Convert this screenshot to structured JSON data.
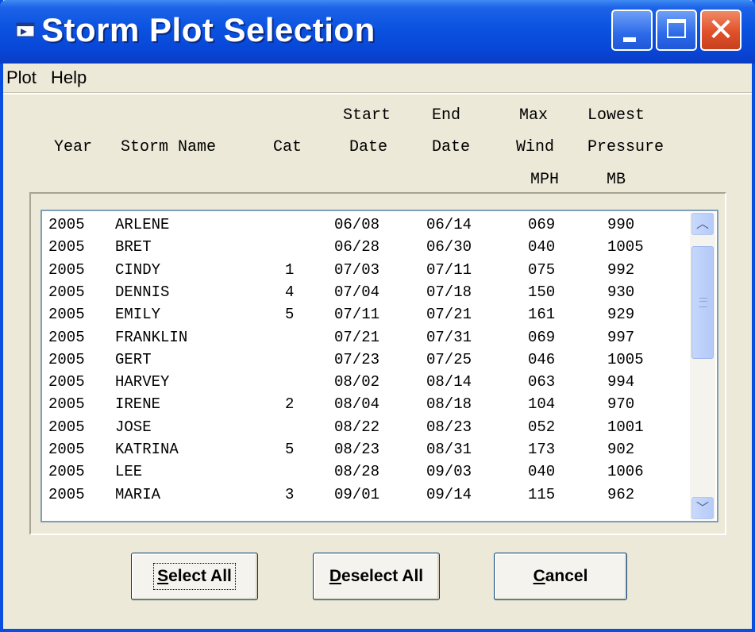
{
  "window": {
    "title": "Storm Plot Selection"
  },
  "menu": [
    {
      "label": "Plot"
    },
    {
      "label": "Help"
    }
  ],
  "headers": {
    "year": "Year",
    "storm_name": "Storm Name",
    "cat": "Cat",
    "start_top": "Start",
    "start_bottom": "Date",
    "end_top": "End",
    "end_bottom": "Date",
    "wind_top": "Max",
    "wind_mid": "Wind",
    "wind_unit": "MPH",
    "pressure_top": "Lowest",
    "pressure_mid": "Pressure",
    "pressure_unit": "MB"
  },
  "storms": [
    {
      "year": "2005",
      "name": "ARLENE",
      "cat": "",
      "start": "06/08",
      "end": "06/14",
      "wind": "069",
      "pressure": "990"
    },
    {
      "year": "2005",
      "name": "BRET",
      "cat": "",
      "start": "06/28",
      "end": "06/30",
      "wind": "040",
      "pressure": "1005"
    },
    {
      "year": "2005",
      "name": "CINDY",
      "cat": "1",
      "start": "07/03",
      "end": "07/11",
      "wind": "075",
      "pressure": "992"
    },
    {
      "year": "2005",
      "name": "DENNIS",
      "cat": "4",
      "start": "07/04",
      "end": "07/18",
      "wind": "150",
      "pressure": "930"
    },
    {
      "year": "2005",
      "name": "EMILY",
      "cat": "5",
      "start": "07/11",
      "end": "07/21",
      "wind": "161",
      "pressure": "929"
    },
    {
      "year": "2005",
      "name": "FRANKLIN",
      "cat": "",
      "start": "07/21",
      "end": "07/31",
      "wind": "069",
      "pressure": "997"
    },
    {
      "year": "2005",
      "name": "GERT",
      "cat": "",
      "start": "07/23",
      "end": "07/25",
      "wind": "046",
      "pressure": "1005"
    },
    {
      "year": "2005",
      "name": "HARVEY",
      "cat": "",
      "start": "08/02",
      "end": "08/14",
      "wind": "063",
      "pressure": "994"
    },
    {
      "year": "2005",
      "name": "IRENE",
      "cat": "2",
      "start": "08/04",
      "end": "08/18",
      "wind": "104",
      "pressure": "970"
    },
    {
      "year": "2005",
      "name": "JOSE",
      "cat": "",
      "start": "08/22",
      "end": "08/23",
      "wind": "052",
      "pressure": "1001"
    },
    {
      "year": "2005",
      "name": "KATRINA",
      "cat": "5",
      "start": "08/23",
      "end": "08/31",
      "wind": "173",
      "pressure": "902"
    },
    {
      "year": "2005",
      "name": "LEE",
      "cat": "",
      "start": "08/28",
      "end": "09/03",
      "wind": "040",
      "pressure": "1006"
    },
    {
      "year": "2005",
      "name": "MARIA",
      "cat": "3",
      "start": "09/01",
      "end": "09/14",
      "wind": "115",
      "pressure": "962"
    }
  ],
  "buttons": {
    "select_all": {
      "mnemonic": "S",
      "rest": "elect All"
    },
    "deselect_all": {
      "mnemonic": "D",
      "rest": "eselect All"
    },
    "cancel": {
      "mnemonic": "C",
      "rest": "ancel"
    }
  },
  "icons": {
    "app": "window-app-icon",
    "minimize": "minimize-icon",
    "maximize": "maximize-icon",
    "close": "close-icon",
    "scroll_up": "chevron-up-icon",
    "scroll_down": "chevron-down-icon"
  },
  "colors": {
    "titlebar": "#0a52e0",
    "close_button": "#e0502a",
    "dialog_background": "#ece9d8",
    "list_background": "#ffffff"
  }
}
